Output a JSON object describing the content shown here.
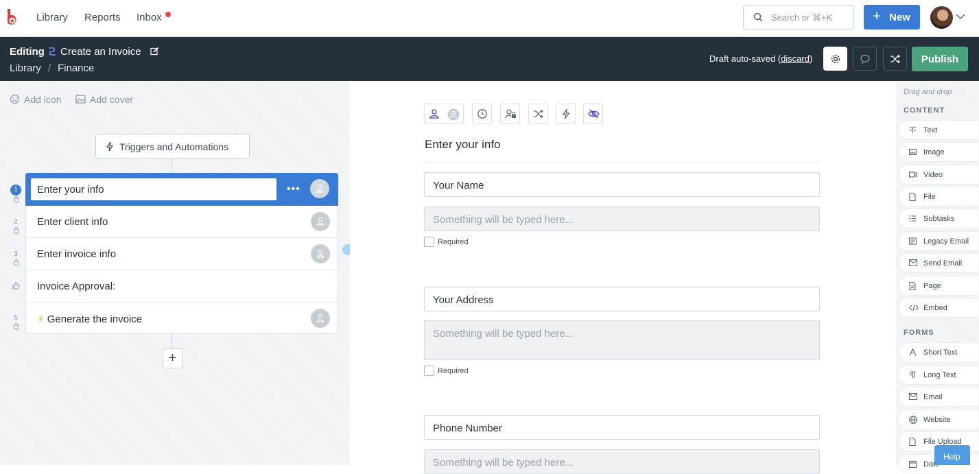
{
  "nav": {
    "links": [
      "Library",
      "Reports",
      "Inbox"
    ],
    "search_placeholder": "Search or ⌘+K",
    "new_label": "New"
  },
  "editbar": {
    "mode": "Editing",
    "title": "Create an Invoice",
    "breadcrumb": [
      "Library",
      "Finance"
    ],
    "breadcrumb_sep": "/",
    "draft_text": "Draft auto-saved",
    "discard": "discard",
    "publish": "Publish"
  },
  "left": {
    "add_icon": "Add icon",
    "add_cover": "Add cover",
    "triggers": "Triggers and Automations",
    "steps": [
      {
        "num": "1",
        "label": "Enter your info",
        "icon": "hand-icon"
      },
      {
        "num": "2",
        "label": "Enter client info",
        "icon": "hand-icon"
      },
      {
        "num": "3",
        "label": "Enter invoice info",
        "icon": "hand-icon"
      },
      {
        "num": "",
        "label": "Invoice Approval:",
        "icon": "thumbs-up-icon"
      },
      {
        "num": "5",
        "label": "Generate the invoice",
        "icon": "hand-icon",
        "prefix": "⚡"
      }
    ],
    "add_step": "+"
  },
  "form": {
    "title": "Enter your info",
    "fields": [
      {
        "label": "Your Name",
        "placeholder": "Something will be typed here...",
        "required": "Required"
      },
      {
        "label": "Your Address",
        "placeholder": "Something will be typed here...",
        "required": "Required"
      },
      {
        "label": "Phone Number",
        "placeholder": "Something will be typed here..."
      }
    ]
  },
  "palette": {
    "hint": "Drag and drop",
    "content_title": "CONTENT",
    "content": [
      "Text",
      "Image",
      "Video",
      "File",
      "Subtasks",
      "Legacy Email",
      "Send Email",
      "Page",
      "Embed"
    ],
    "forms_title": "FORMS",
    "forms": [
      "Short Text",
      "Long Text",
      "Email",
      "Website",
      "File Upload",
      "Date"
    ]
  },
  "help": "Help",
  "colors": {
    "accent": "#3a7bd5",
    "header_bg": "#25303b",
    "publish": "#4aa37d"
  }
}
